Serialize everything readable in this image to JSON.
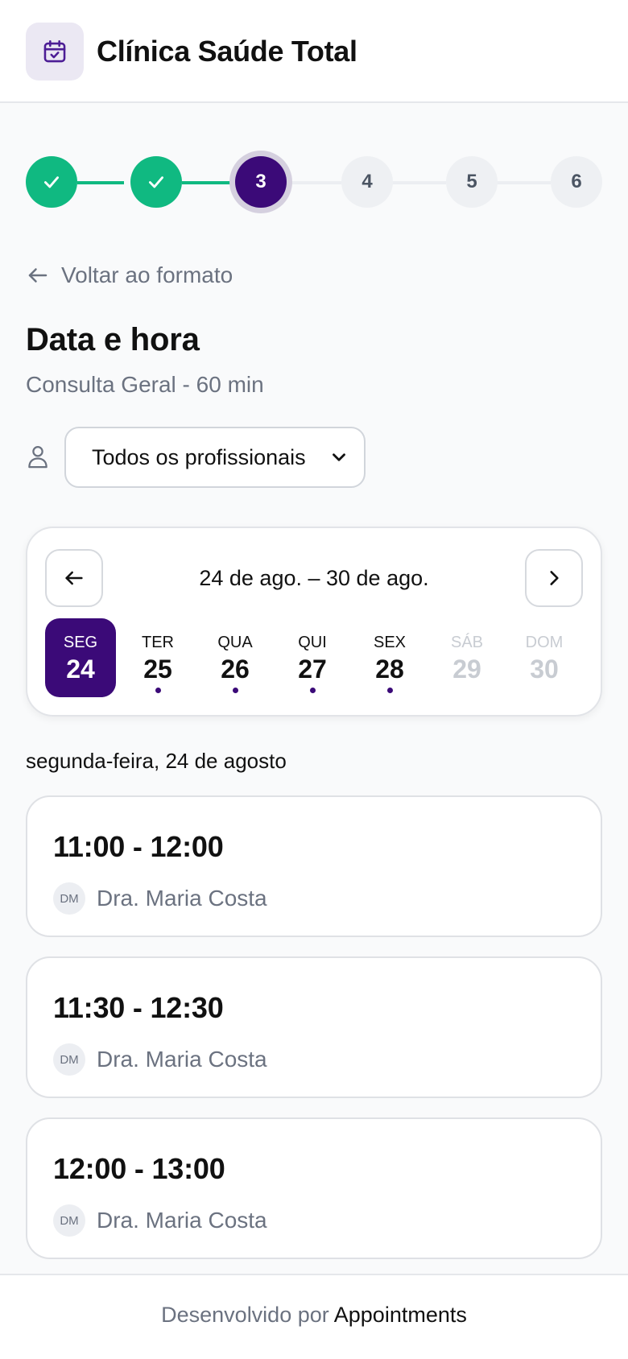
{
  "header": {
    "clinic_name": "Clínica Saúde Total",
    "logo_icon": "calendar-check-icon"
  },
  "stepper": {
    "current_step": 3,
    "steps": [
      {
        "label": "1",
        "status": "done"
      },
      {
        "label": "2",
        "status": "done"
      },
      {
        "label": "3",
        "status": "current"
      },
      {
        "label": "4",
        "status": "todo"
      },
      {
        "label": "5",
        "status": "todo"
      },
      {
        "label": "6",
        "status": "todo"
      }
    ]
  },
  "back_link": {
    "label": "Voltar ao formato"
  },
  "page": {
    "title": "Data e hora",
    "subtitle": "Consulta Geral - 60 min"
  },
  "professional_select": {
    "value": "Todos os profissionais",
    "icon": "user-icon"
  },
  "calendar": {
    "range_label": "24 de ago. – 30 de ago.",
    "days": [
      {
        "name": "SEG",
        "number": "24",
        "selected": true,
        "available": true,
        "has_slots": false
      },
      {
        "name": "TER",
        "number": "25",
        "selected": false,
        "available": true,
        "has_slots": true
      },
      {
        "name": "QUA",
        "number": "26",
        "selected": false,
        "available": true,
        "has_slots": true
      },
      {
        "name": "QUI",
        "number": "27",
        "selected": false,
        "available": true,
        "has_slots": true
      },
      {
        "name": "SEX",
        "number": "28",
        "selected": false,
        "available": true,
        "has_slots": true
      },
      {
        "name": "SÁB",
        "number": "29",
        "selected": false,
        "available": false,
        "has_slots": false
      },
      {
        "name": "DOM",
        "number": "30",
        "selected": false,
        "available": false,
        "has_slots": false
      }
    ]
  },
  "selected_date_label": "segunda-feira, 24 de agosto",
  "slots": [
    {
      "time": "11:00 - 12:00",
      "initials": "DM",
      "professional": "Dra. Maria Costa"
    },
    {
      "time": "11:30 - 12:30",
      "initials": "DM",
      "professional": "Dra. Maria Costa"
    },
    {
      "time": "12:00 - 13:00",
      "initials": "DM",
      "professional": "Dra. Maria Costa"
    }
  ],
  "footer": {
    "prefix": "Desenvolvido por",
    "brand": "Appointments"
  },
  "colors": {
    "primary": "#3b0a78",
    "success": "#10b981",
    "muted_text": "#6b7280",
    "disabled_text": "#c8ccd2",
    "logo_bg": "#ebe8f3"
  }
}
